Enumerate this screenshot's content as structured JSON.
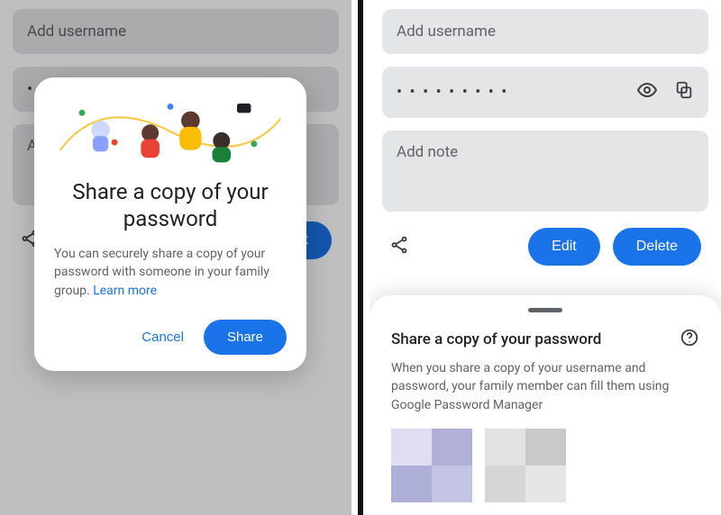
{
  "left": {
    "bg": {
      "username_placeholder": "Add username",
      "edit_label": "Edit"
    },
    "dialog": {
      "title": "Share a copy of your password",
      "body": "You can securely share a copy of your password with someone in your family group. ",
      "learn_more": "Learn more",
      "cancel_label": "Cancel",
      "share_label": "Share"
    }
  },
  "right": {
    "bg": {
      "username_placeholder": "Add username",
      "password_masked": "• • • • • • • • •",
      "note_placeholder": "Add note",
      "edit_label": "Edit",
      "delete_label": "Delete"
    },
    "sheet": {
      "title": "Share a copy of your password",
      "body": "When you share a copy of your username and password, your family member can fill them using Google Password Manager"
    }
  }
}
